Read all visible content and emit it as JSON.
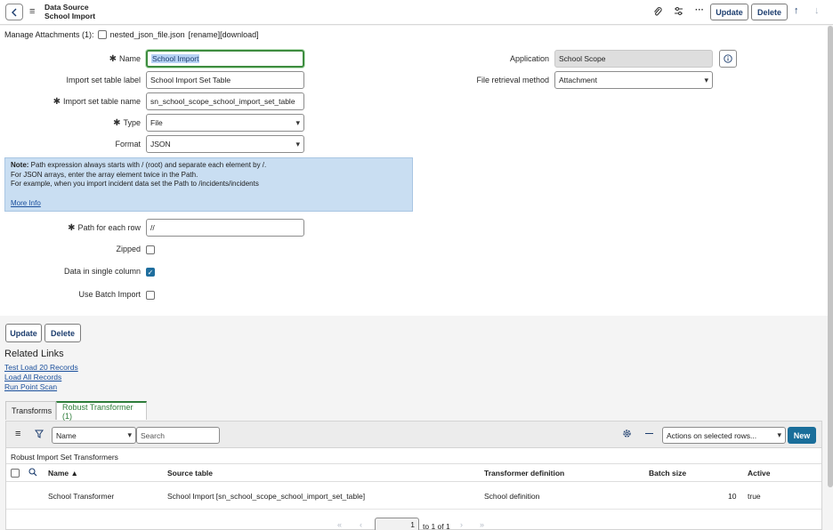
{
  "header": {
    "title_line1": "Data Source",
    "title_line2": "School Import",
    "update_label": "Update",
    "delete_label": "Delete",
    "more_label": "···"
  },
  "attachments": {
    "label": "Manage Attachments (1):",
    "file": "nested_json_file.json",
    "actions": "[rename][download]"
  },
  "form": {
    "name_label": "Name",
    "name_value": "School Import",
    "import_label_label": "Import set table label",
    "import_label_value": "School Import Set Table",
    "import_name_label": "Import set table name",
    "import_name_value": "sn_school_scope_school_import_set_table",
    "type_label": "Type",
    "type_value": "File",
    "format_label": "Format",
    "format_value": "JSON",
    "application_label": "Application",
    "application_value": "School Scope",
    "file_retrieval_label": "File retrieval method",
    "file_retrieval_value": "Attachment",
    "path_label": "Path for each row",
    "path_value": "//",
    "zipped_label": "Zipped",
    "single_column_label": "Data in single column",
    "batch_label": "Use Batch Import"
  },
  "note": {
    "bold": "Note:",
    "line1": " Path expression always starts with / (root) and separate each element by /.",
    "line2": "For JSON arrays, enter the array element twice in the Path.",
    "line3": "For example, when you import incident data set the Path to /incidents/incidents",
    "link": "More Info"
  },
  "footer_buttons": {
    "update": "Update",
    "delete": "Delete"
  },
  "related": {
    "title": "Related Links",
    "links": [
      "Test Load 20 Records",
      "Load All Records",
      "Run Point Scan"
    ]
  },
  "tabs": [
    "Transforms",
    "Robust Transformer (1)"
  ],
  "list": {
    "field_select": "Name",
    "search_placeholder": "Search",
    "actions_select": "Actions on selected rows...",
    "new_label": "New",
    "caption": "Robust Import Set Transformers",
    "columns": [
      "Name ▲",
      "Source table",
      "Transformer definition",
      "Batch size",
      "Active"
    ],
    "row": {
      "name": "School Transformer",
      "source": "School Import [sn_school_scope_school_import_set_table]",
      "definition": "School definition",
      "batch": "10",
      "active": "true"
    },
    "pager_value": "1",
    "pager_text": "to 1 of 1"
  }
}
